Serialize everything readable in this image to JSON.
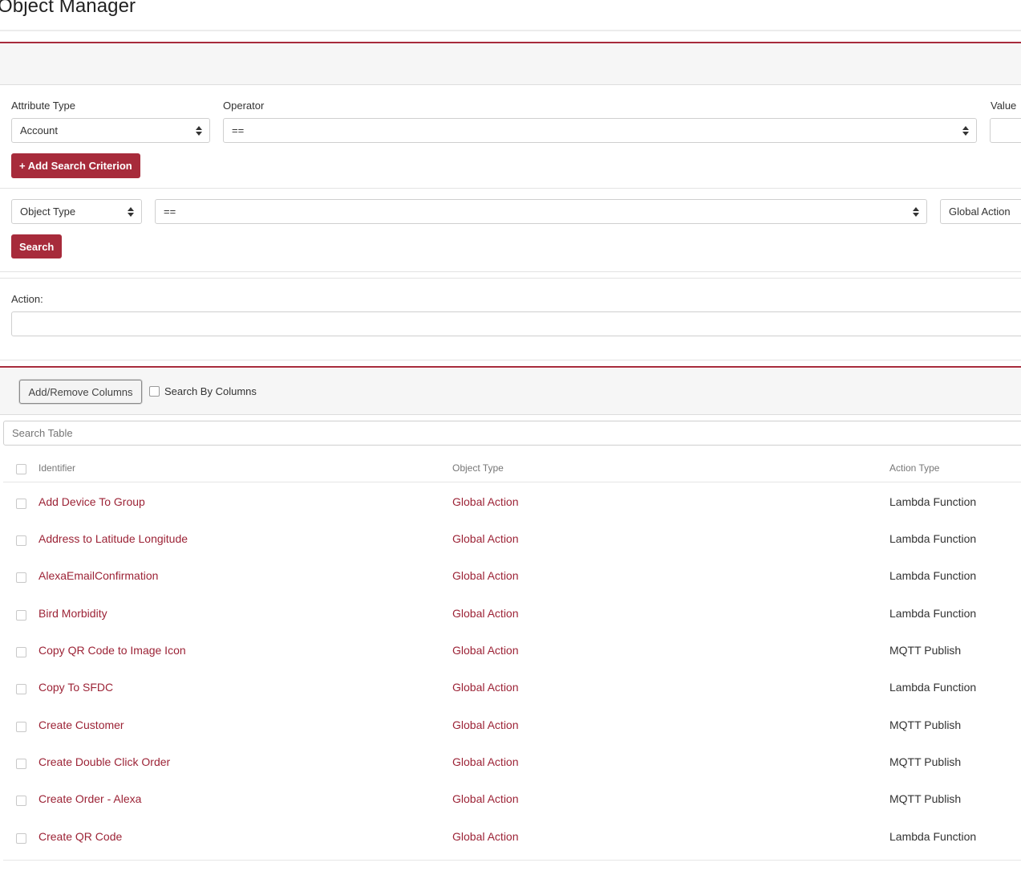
{
  "page": {
    "title": "Object Manager"
  },
  "criteria": {
    "attribute_type_label": "Attribute Type",
    "attribute_type_value": "Account",
    "operator_label": "Operator",
    "operator_value": "==",
    "value_label": "Value",
    "add_button": "+ Add Search Criterion"
  },
  "filter": {
    "object_type_value": "Object Type",
    "operator_value": "==",
    "value": "Global Action",
    "search_button": "Search"
  },
  "action": {
    "label": "Action:",
    "value": ""
  },
  "toolbar": {
    "add_remove_columns": "Add/Remove Columns",
    "search_by_columns_label": "Search By Columns",
    "search_by_columns_checked": false,
    "search_placeholder": "Search Table"
  },
  "table": {
    "columns": [
      "Identifier",
      "Object Type",
      "Action Type"
    ],
    "rows": [
      {
        "identifier": "Add Device To Group",
        "object_type": "Global Action",
        "action_type": "Lambda Function"
      },
      {
        "identifier": "Address to Latitude Longitude",
        "object_type": "Global Action",
        "action_type": "Lambda Function"
      },
      {
        "identifier": "AlexaEmailConfirmation",
        "object_type": "Global Action",
        "action_type": "Lambda Function"
      },
      {
        "identifier": "Bird Morbidity",
        "object_type": "Global Action",
        "action_type": "Lambda Function"
      },
      {
        "identifier": "Copy QR Code to Image Icon",
        "object_type": "Global Action",
        "action_type": "MQTT Publish"
      },
      {
        "identifier": "Copy To SFDC",
        "object_type": "Global Action",
        "action_type": "Lambda Function"
      },
      {
        "identifier": "Create Customer",
        "object_type": "Global Action",
        "action_type": "MQTT Publish"
      },
      {
        "identifier": "Create Double Click Order",
        "object_type": "Global Action",
        "action_type": "MQTT Publish"
      },
      {
        "identifier": "Create Order - Alexa",
        "object_type": "Global Action",
        "action_type": "MQTT Publish"
      },
      {
        "identifier": "Create QR Code",
        "object_type": "Global Action",
        "action_type": "Lambda Function"
      }
    ]
  },
  "colors": {
    "accent": "#a72b3b",
    "link": "#9c2336"
  }
}
